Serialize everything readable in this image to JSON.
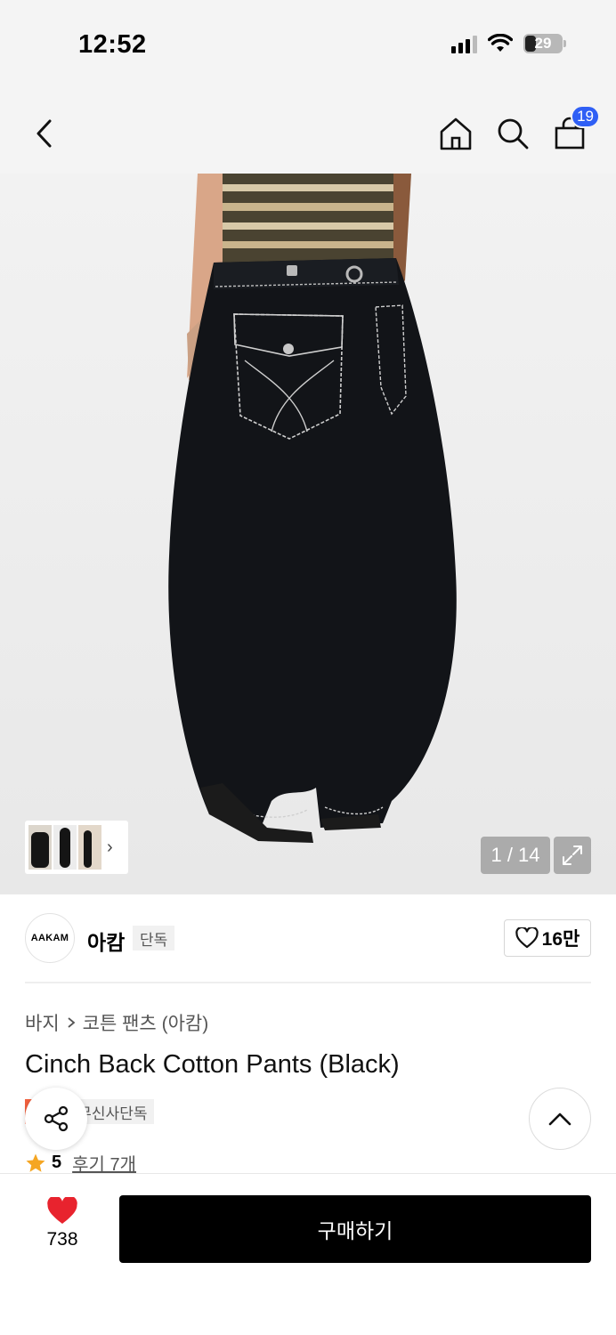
{
  "status_bar": {
    "time": "12:52",
    "battery": "29"
  },
  "nav": {
    "back_icon": "chevron-left-icon",
    "home_icon": "home-icon",
    "search_icon": "search-icon",
    "cart_icon": "shopping-bag-icon",
    "cart_count": "19"
  },
  "gallery": {
    "pager": "1 / 14",
    "expand_icon": "expand-icon",
    "thumbnail_more_icon": "chevron-right-icon"
  },
  "brand": {
    "logo_text": "AAKAM",
    "name": "아캄",
    "tag": "단독",
    "likes": "16만"
  },
  "product": {
    "breadcrumb": [
      "바지",
      "코튼 팬츠 (아캄)"
    ],
    "title": "Cinch Back Cotton Pants (Black)",
    "badge_sale": "세일",
    "badge_exclusive": "무신사단독",
    "rating_score": "5",
    "review_text": "후기 7개"
  },
  "bottom_bar": {
    "heart_count": "738",
    "buy_label": "구매하기"
  },
  "colors": {
    "accent_blue": "#2f5ff5",
    "sale_orange": "#f2613f",
    "heart_red": "#e8232e",
    "star_orange": "#f5a623"
  }
}
